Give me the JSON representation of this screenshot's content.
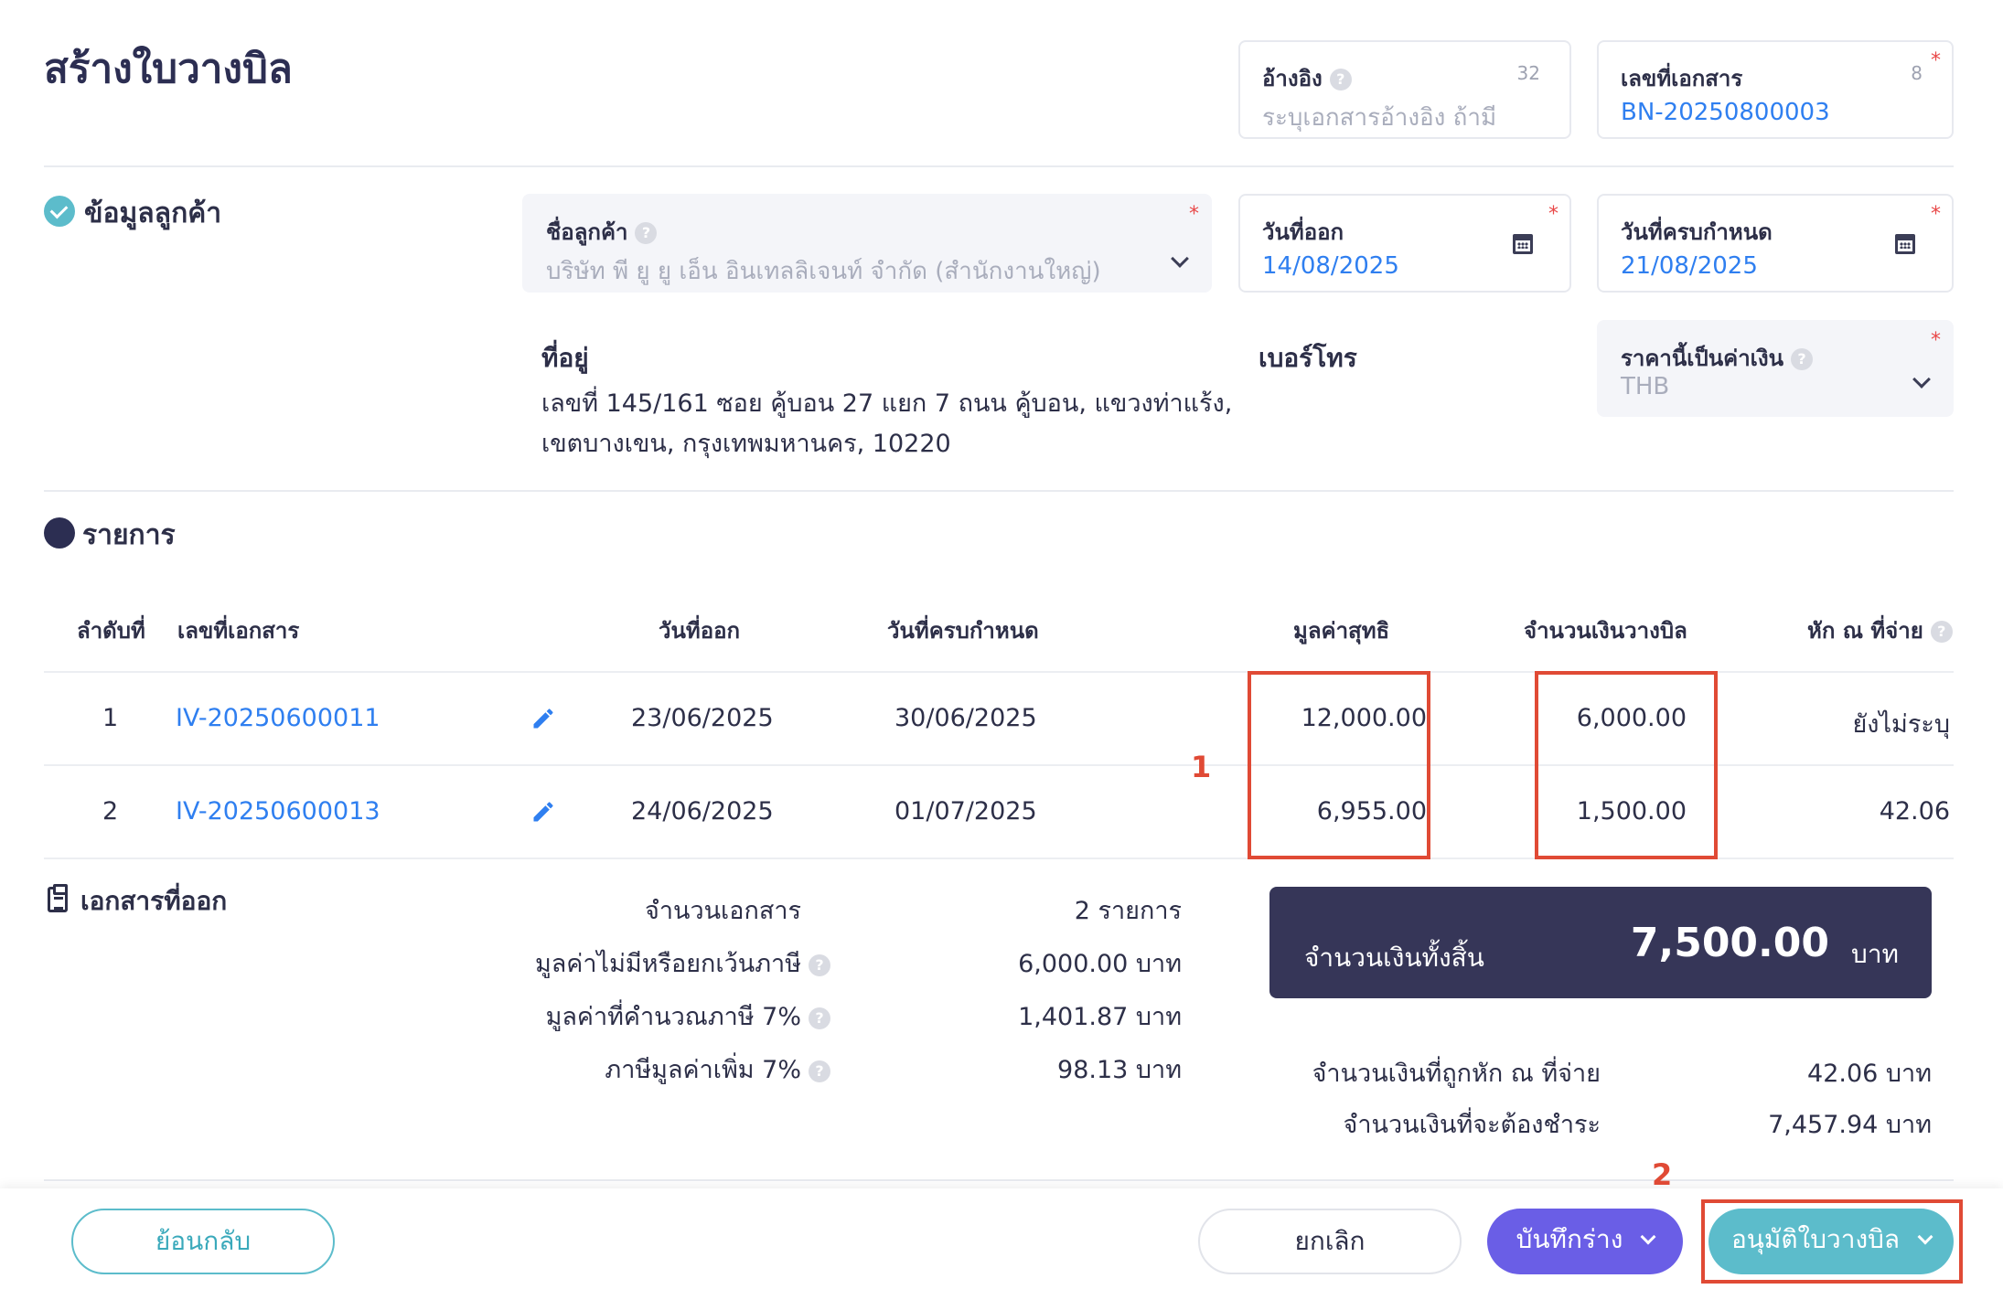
{
  "page": {
    "title": "สร้างใบวางบิล"
  },
  "header_fields": {
    "reference": {
      "label": "อ้างอิง",
      "placeholder": "ระบุเอกสารอ้างอิง ถ้ามี",
      "count": "32"
    },
    "doc_number": {
      "label": "เลขที่เอกสาร",
      "value": "BN-20250800003",
      "count": "8"
    }
  },
  "customer_section": {
    "title": "ข้อมูลลูกค้า",
    "customer_name": {
      "label": "ชื่อลูกค้า",
      "value": "บริษัท พี ยู ยู เอ็น อินเทลลิเจนท์ จำกัด (สำนักงานใหญ่)"
    },
    "issue_date": {
      "label": "วันที่ออก",
      "value": "14/08/2025"
    },
    "due_date": {
      "label": "วันที่ครบกำหนด",
      "value": "21/08/2025"
    },
    "address": {
      "label": "ที่อยู่",
      "line1": "เลขที่ 145/161 ซอย คู้บอน 27 แยก 7 ถนน คู้บอน, แขวงท่าแร้ง,",
      "line2": "เขตบางเขน, กรุงเทพมหานคร, 10220"
    },
    "phone": {
      "label": "เบอร์โทร"
    },
    "currency": {
      "label": "ราคานี้เป็นค่าเงิน",
      "value": "THB"
    }
  },
  "items_section": {
    "title": "รายการ",
    "columns": {
      "index": "ลำดับที่",
      "doc_number": "เลขที่เอกสาร",
      "issue_date": "วันที่ออก",
      "due_date": "วันที่ครบกำหนด",
      "net_value": "มูลค่าสุทธิ",
      "billing_amount": "จำนวนเงินวางบิล",
      "withholding": "หัก ณ ที่จ่าย"
    },
    "rows": [
      {
        "index": "1",
        "doc_number": "IV-20250600011",
        "issue_date": "23/06/2025",
        "due_date": "30/06/2025",
        "net_value": "12,000.00",
        "billing_amount": "6,000.00",
        "withholding": "ยังไม่ระบุ"
      },
      {
        "index": "2",
        "doc_number": "IV-20250600013",
        "issue_date": "24/06/2025",
        "due_date": "01/07/2025",
        "net_value": "6,955.00",
        "billing_amount": "1,500.00",
        "withholding": "42.06"
      }
    ]
  },
  "summary": {
    "title": "เอกสารที่ออก",
    "doc_count_label": "จำนวนเอกสาร",
    "doc_count_value": "2 รายการ",
    "non_taxable_label": "มูลค่าไม่มีหรือยกเว้นภาษี",
    "non_taxable_value": "6,000.00 บาท",
    "taxable_label": "มูลค่าที่คำนวณภาษี 7%",
    "taxable_value": "1,401.87 บาท",
    "vat_label": "ภาษีมูลค่าเพิ่ม 7%",
    "vat_value": "98.13 บาท",
    "total_label": "จำนวนเงินทั้งสิ้น",
    "total_value": "7,500.00",
    "total_unit": "บาท",
    "withheld_label": "จำนวนเงินที่ถูกหัก ณ ที่จ่าย",
    "withheld_value": "42.06 บาท",
    "payable_label": "จำนวนเงินที่จะต้องชำระ",
    "payable_value": "7,457.94 บาท"
  },
  "annotations": {
    "marker1": "1",
    "marker2": "2"
  },
  "footer": {
    "back_label": "ย้อนกลับ",
    "cancel_label": "ยกเลิก",
    "save_draft_label": "บันทึกร่าง",
    "approve_label": "อนุมัติใบวางบิล"
  },
  "colors": {
    "accent_teal": "#5cbccb",
    "accent_purple": "#6a5ee6",
    "link_blue": "#2f7ff0",
    "total_bg": "#363658",
    "annotation_red": "#e04a35"
  }
}
